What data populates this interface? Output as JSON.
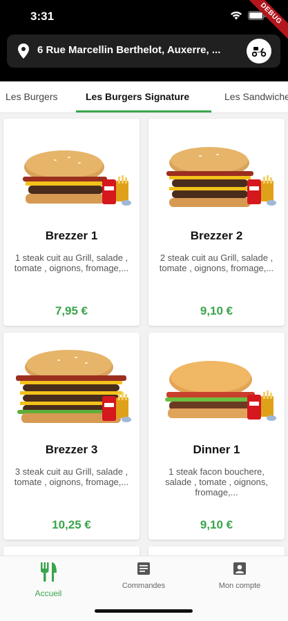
{
  "status_bar": {
    "time": "3:31",
    "debug_label": "DEBUG"
  },
  "address": {
    "text": "6 Rue Marcellin Berthelot, Auxerre, ..."
  },
  "tabs": [
    {
      "label": "Les Burgers",
      "active": false
    },
    {
      "label": "Les Burgers Signature",
      "active": true
    },
    {
      "label": "Les Sandwiches",
      "active": false
    }
  ],
  "products": [
    {
      "name": "Brezzer 1",
      "description": "1 steak cuit au Grill, salade , tomate , oignons, fromage,...",
      "price": "7,95 €"
    },
    {
      "name": "Brezzer 2",
      "description": "2 steak cuit au Grill, salade , tomate , oignons, fromage,...",
      "price": "9,10 €"
    },
    {
      "name": "Brezzer 3",
      "description": "3 steak cuit au Grill, salade , tomate , oignons, fromage,...",
      "price": "10,25 €"
    },
    {
      "name": "Dinner 1",
      "description": "1 steak facon bouchere, salade , tomate , oignons, fromage,...",
      "price": "9,10 €"
    }
  ],
  "bottom_nav": [
    {
      "label": "Accueil",
      "icon": "fork-knife-icon",
      "active": true
    },
    {
      "label": "Commandes",
      "icon": "receipt-icon",
      "active": false
    },
    {
      "label": "Mon compte",
      "icon": "account-icon",
      "active": false
    }
  ],
  "colors": {
    "accent": "#3aa44b",
    "header_bg": "#000000",
    "address_bg": "#202020"
  }
}
